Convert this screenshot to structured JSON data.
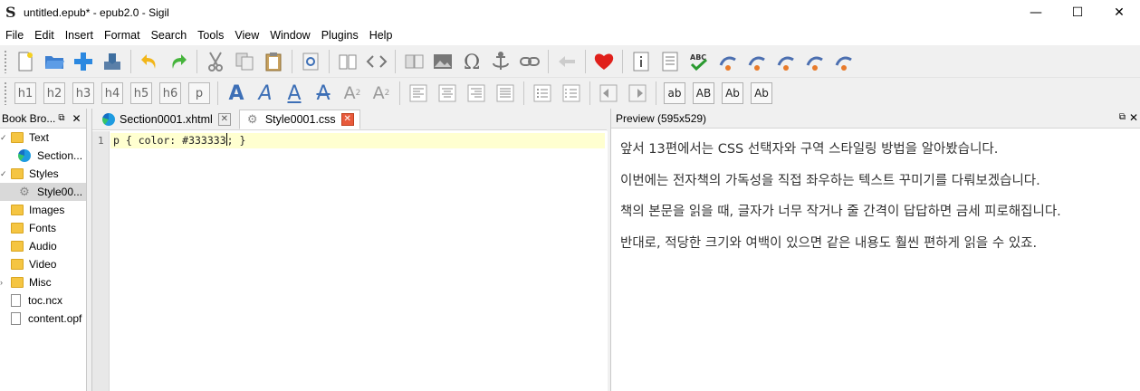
{
  "window": {
    "title": "untitled.epub* - epub2.0 - Sigil",
    "controls": {
      "minimize": "—",
      "maximize": "☐",
      "close": "✕"
    }
  },
  "menu": [
    "File",
    "Edit",
    "Insert",
    "Format",
    "Search",
    "Tools",
    "View",
    "Window",
    "Plugins",
    "Help"
  ],
  "toolbar2": {
    "headings": [
      "h1",
      "h2",
      "h3",
      "h4",
      "h5",
      "h6",
      "p"
    ],
    "text_styles": [
      "A",
      "A",
      "A",
      "A"
    ],
    "subscript": "A",
    "subscript_mark": "2",
    "superscript": "A",
    "superscript_mark": "2",
    "case_buttons": [
      "ab",
      "AB",
      "Ab",
      "Ab"
    ]
  },
  "book_browser": {
    "title": "Book Bro...",
    "items": [
      {
        "label": "Text",
        "kind": "folder",
        "expanded": true
      },
      {
        "label": "Section...",
        "kind": "xhtml"
      },
      {
        "label": "Styles",
        "kind": "folder",
        "expanded": true
      },
      {
        "label": "Style00...",
        "kind": "css",
        "selected": true
      },
      {
        "label": "Images",
        "kind": "folder"
      },
      {
        "label": "Fonts",
        "kind": "folder"
      },
      {
        "label": "Audio",
        "kind": "folder"
      },
      {
        "label": "Video",
        "kind": "folder"
      },
      {
        "label": "Misc",
        "kind": "folder",
        "collapsed": true
      },
      {
        "label": "toc.ncx",
        "kind": "file"
      },
      {
        "label": "content.opf",
        "kind": "file"
      }
    ]
  },
  "editor": {
    "tabs": [
      {
        "label": "Section0001.xhtml",
        "active": false
      },
      {
        "label": "Style0001.css",
        "active": true
      }
    ],
    "line_number": "1",
    "code_before_cursor": "p { color: #333333",
    "code_after_cursor": "; }"
  },
  "preview": {
    "title": "Preview (595x529)",
    "paragraphs": [
      "앞서 13편에서는 CSS 선택자와 구역 스타일링 방법을 알아봤습니다.",
      "이번에는 전자책의 가독성을 직접 좌우하는 텍스트 꾸미기를 다뤄보겠습니다.",
      "책의 본문을 읽을 때, 글자가 너무 작거나 줄 간격이 답답하면 금세 피로해집니다.",
      "반대로, 적당한 크기와 여백이 있으면 같은 내용도 훨씬 편하게 읽을 수 있죠."
    ]
  },
  "colors": {
    "toolbar_bg": "#f0f0f0",
    "current_line": "#ffffd0",
    "folder": "#f5c542",
    "active_tab_close": "#e85a3c",
    "format_blue": "#3d6fb6"
  }
}
